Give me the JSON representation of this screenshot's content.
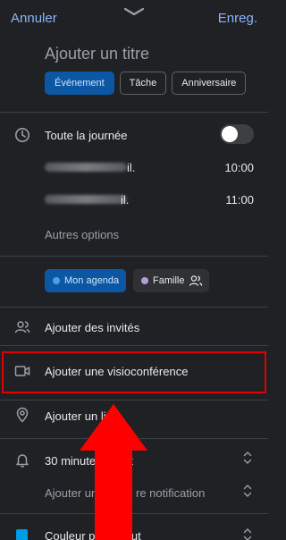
{
  "header": {
    "cancel_label": "Annuler",
    "save_label": "Enreg."
  },
  "title": {
    "placeholder": "Ajouter un titre"
  },
  "event_types": [
    {
      "label": "Événement",
      "selected": true
    },
    {
      "label": "Tâche",
      "selected": false
    },
    {
      "label": "Anniversaire",
      "selected": false
    }
  ],
  "all_day": {
    "label": "Toute la journée",
    "enabled": false
  },
  "start": {
    "date_suffix": "il.",
    "time": "10:00"
  },
  "end": {
    "date_suffix": "il.",
    "time": "11:00"
  },
  "more_options_label": "Autres options",
  "calendars": [
    {
      "label": "Mon agenda",
      "color": "#4a9ee8",
      "selected": true
    },
    {
      "label": "Famille",
      "color": "#b39ddb",
      "selected": false
    }
  ],
  "guests_label": "Ajouter des invités",
  "video_label": "Ajouter une visioconférence",
  "location_label": "Ajouter un li",
  "notification": {
    "label": "30 minute",
    "label_tail": "nt",
    "add_label": "Ajouter un",
    "add_label_tail": "re notification"
  },
  "color_label": "Couleur par défaut",
  "colors": {
    "accent": "#8ab4f8",
    "background": "#202124",
    "highlight": "#e00000",
    "arrow": "#ff0000"
  }
}
